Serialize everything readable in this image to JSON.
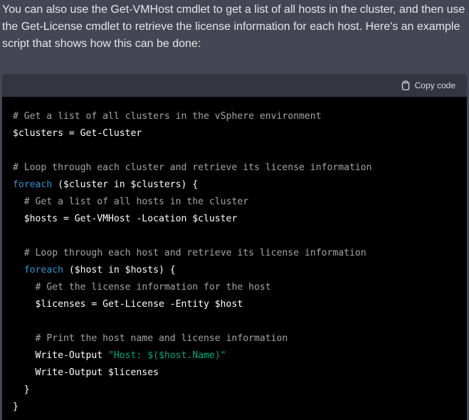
{
  "message": {
    "intro_text": "You can also use the Get-VMHost cmdlet to get a list of all hosts in the cluster, and then use the Get-License cmdlet to retrieve the license information for each host. Here's an example script that shows how this can be done:"
  },
  "code_block": {
    "copy_label": "Copy code",
    "copy_icon": "clipboard-icon",
    "lines": [
      [
        {
          "t": "c",
          "v": "# Get a list of all clusters in the vSphere environment"
        }
      ],
      [
        {
          "t": "p",
          "v": "$clusters = Get-Cluster"
        }
      ],
      [],
      [
        {
          "t": "c",
          "v": "# Loop through each cluster and retrieve its license information"
        }
      ],
      [
        {
          "t": "k",
          "v": "foreach"
        },
        {
          "t": "p",
          "v": " ($cluster in $clusters) {"
        }
      ],
      [
        {
          "t": "p",
          "v": "  "
        },
        {
          "t": "c",
          "v": "# Get a list of all hosts in the cluster"
        }
      ],
      [
        {
          "t": "p",
          "v": "  $hosts = Get-VMHost -Location $cluster"
        }
      ],
      [],
      [
        {
          "t": "p",
          "v": "  "
        },
        {
          "t": "c",
          "v": "# Loop through each host and retrieve its license information"
        }
      ],
      [
        {
          "t": "p",
          "v": "  "
        },
        {
          "t": "k",
          "v": "foreach"
        },
        {
          "t": "p",
          "v": " ($host in $hosts) {"
        }
      ],
      [
        {
          "t": "p",
          "v": "    "
        },
        {
          "t": "c",
          "v": "# Get the license information for the host"
        }
      ],
      [
        {
          "t": "p",
          "v": "    $licenses = Get-License -Entity $host"
        }
      ],
      [],
      [
        {
          "t": "p",
          "v": "    "
        },
        {
          "t": "c",
          "v": "# Print the host name and license information"
        }
      ],
      [
        {
          "t": "p",
          "v": "    Write-Output "
        },
        {
          "t": "s",
          "v": "\"Host: $($host.Name)\""
        }
      ],
      [
        {
          "t": "p",
          "v": "    Write-Output $licenses"
        }
      ],
      [
        {
          "t": "p",
          "v": "  }"
        }
      ],
      [
        {
          "t": "p",
          "v": "}"
        }
      ]
    ]
  },
  "colors": {
    "page_bg": "#444654",
    "code_header_bg": "#343541",
    "code_bg": "#000000",
    "comment": "#a4a4a4",
    "keyword": "#2e95d3",
    "string": "#00a67d"
  }
}
